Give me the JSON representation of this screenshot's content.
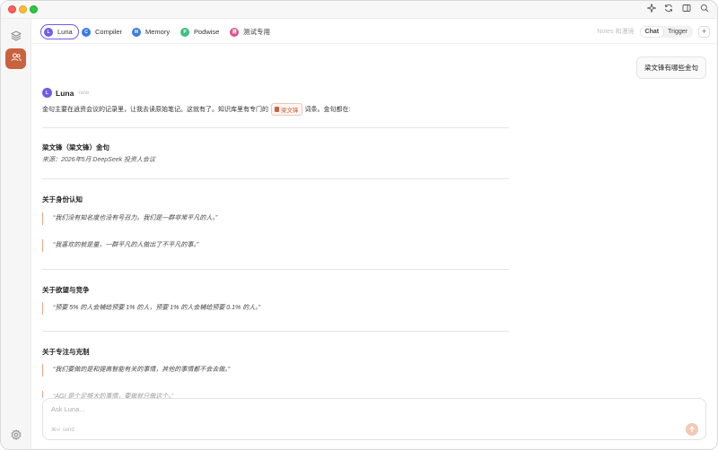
{
  "tabs": [
    {
      "initial": "L",
      "label": "Luna",
      "color": "#6e5ce8",
      "active": true
    },
    {
      "initial": "C",
      "label": "Compiler",
      "color": "#3b7be0"
    },
    {
      "initial": "M",
      "label": "Memory",
      "color": "#3b7be0"
    },
    {
      "initial": "P",
      "label": "Podwise",
      "color": "#3fbf7f"
    },
    {
      "initial": "测",
      "label": "测试专用",
      "color": "#d94f8a"
    }
  ],
  "header": {
    "notes_label": "Notes 和漫境",
    "chat_label": "Chat",
    "trigger_label": "Trigger",
    "add_label": "+"
  },
  "user_message": "梁文锋有哪些金句",
  "assistant": {
    "avatar_initial": "L",
    "name": "Luna",
    "time": "now",
    "intro_before": "金句主要在逍资会议的记录里，让我去读原始笔记。这就有了。知识库里有专门的",
    "kb_chip": "梁文锋",
    "intro_after": "词条。金句都在:",
    "heading": "梁文锋（梁文锋）金句",
    "source": "来源：2026年5月 DeepSeek 投资人会议",
    "sections": [
      {
        "title": "关于身份认知",
        "quotes": [
          "“我们没有知名度也没有号召力。我们是一群非常平凡的人。”",
          "“我喜欢的就是量，一群平凡的人做出了不平凡的事。”"
        ]
      },
      {
        "title": "关于欲望与竞争",
        "quotes": [
          "“预要 5% 的人会辅给预要 1% 的人，预要 1% 的人会辅给预要 0.1% 的人。”"
        ]
      },
      {
        "title": "关于专注与克制",
        "quotes": [
          "“我们要做的是和提高智能有关的事情，其他的事情都不会去做。”",
          "“AGI 是个足够大的事情，要做就只做这个。”"
        ]
      }
    ]
  },
  "input": {
    "placeholder": "Ask Luna...",
    "send_hint": "⌘↵ send"
  },
  "colors": {
    "accent": "#c8623f",
    "active_tab_border": "#6e5ce8"
  },
  "icons": {
    "titlebar": [
      "sparkle-icon",
      "refresh-icon",
      "sidebar-toggle-icon",
      "search-icon"
    ],
    "rail": [
      "layers-icon",
      "users-icon",
      "settings-icon"
    ]
  }
}
